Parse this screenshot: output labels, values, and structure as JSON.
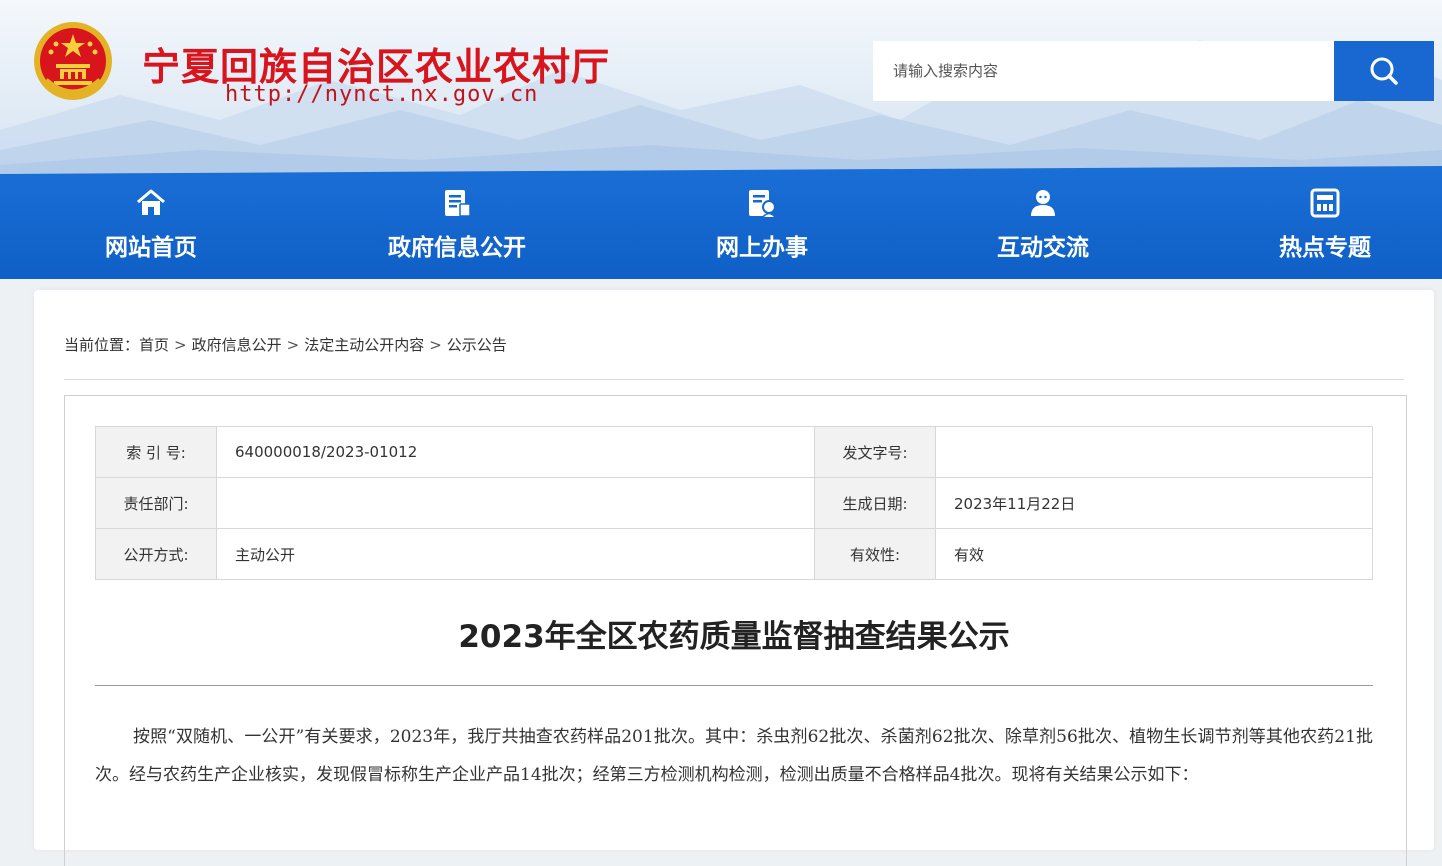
{
  "header": {
    "site_title": "宁夏回族自治区农业农村厅",
    "site_url": "http://nynct.nx.gov.cn",
    "search_placeholder": "请输入搜索内容"
  },
  "nav": {
    "items": [
      {
        "label": "网站首页",
        "icon": "home-icon"
      },
      {
        "label": "政府信息公开",
        "icon": "document-icon"
      },
      {
        "label": "网上办事",
        "icon": "service-icon"
      },
      {
        "label": "互动交流",
        "icon": "user-chat-icon"
      },
      {
        "label": "热点专题",
        "icon": "topic-icon"
      }
    ]
  },
  "breadcrumb": {
    "prefix": "当前位置：",
    "items": [
      "首页",
      "政府信息公开",
      "法定主动公开内容",
      "公示公告"
    ],
    "separator": ">"
  },
  "meta": {
    "index_label": "索 引 号:",
    "index_value": "640000018/2023-01012",
    "doc_no_label": "发文字号:",
    "doc_no_value": "",
    "dept_label": "责任部门:",
    "dept_value": "",
    "date_label": "生成日期:",
    "date_value": "2023年11月22日",
    "method_label": "公开方式:",
    "method_value": "主动公开",
    "validity_label": "有效性:",
    "validity_value": "有效"
  },
  "article": {
    "title": "2023年全区农药质量监督抽查结果公示",
    "paragraph": "按照“双随机、一公开”有关要求，2023年，我厅共抽查农药样品201批次。其中：杀虫剂62批次、杀菌剂62批次、除草剂56批次、植物生长调节剂等其他农药21批次。经与农药生产企业核实，发现假冒标称生产企业产品14批次；经第三方检测机构检测，检测出质量不合格样品4批次。现将有关结果公示如下："
  },
  "colors": {
    "brand_red": "#d8141d",
    "nav_blue": "#1468d0",
    "search_blue": "#1968d2"
  }
}
